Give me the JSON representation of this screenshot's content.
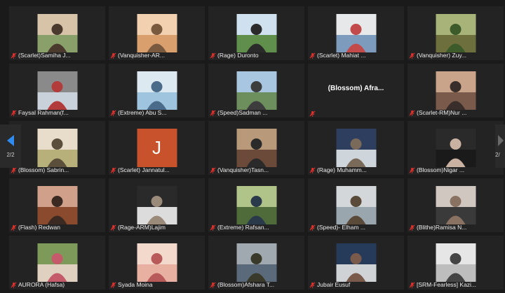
{
  "navigation": {
    "left_page": "2/2",
    "right_page": "2/"
  },
  "colors": {
    "background": "#1a1a1a",
    "tile": "#232323",
    "mic_muted": "#e5322d",
    "nav_arrow": "#2e8cf0",
    "initial_avatar": "#c8522b"
  },
  "participants": [
    {
      "label": "(Scarlet)Samiha J...",
      "avatar": "photo"
    },
    {
      "label": "(Vanquisher-AR...",
      "avatar": "photo"
    },
    {
      "label": "(Rage) Duronto",
      "avatar": "photo"
    },
    {
      "label": "(Scarlet) Mahiat ...",
      "avatar": "photo"
    },
    {
      "label": "(Vanquisher) Zuy...",
      "avatar": "photo"
    },
    {
      "label": "Faysal Rahman(f...",
      "avatar": "photo"
    },
    {
      "label": "(Extreme) Abu S...",
      "avatar": "photo"
    },
    {
      "label": "(Speed)Sadman ...",
      "avatar": "photo"
    },
    {
      "label": "",
      "avatar": "none",
      "display_name": "(Blossom) Afra..."
    },
    {
      "label": "(Scarlet-RM)Nur ...",
      "avatar": "photo"
    },
    {
      "label": "(Blossom) Sabrin...",
      "avatar": "photo"
    },
    {
      "label": "(Scarlet) Jannatul...",
      "avatar": "initial",
      "initial": "J"
    },
    {
      "label": "(Vanquisher)Tasn...",
      "avatar": "photo"
    },
    {
      "label": "(Rage) Muhamm...",
      "avatar": "photo"
    },
    {
      "label": "(Blossom)Nigar ...",
      "avatar": "photo"
    },
    {
      "label": "(Flash) Redwan",
      "avatar": "photo"
    },
    {
      "label": "(Rage-ARM)Lajim",
      "avatar": "photo"
    },
    {
      "label": "(Extreme) Rafsan...",
      "avatar": "photo"
    },
    {
      "label": "(Speed)- Elham ...",
      "avatar": "photo"
    },
    {
      "label": "(Blithe)Ramisa N...",
      "avatar": "photo"
    },
    {
      "label": "AURORA (Hafsa)",
      "avatar": "photo"
    },
    {
      "label": "Syada Moina",
      "avatar": "photo"
    },
    {
      "label": "(Blossom)Afshara T...",
      "avatar": "photo"
    },
    {
      "label": "Jubair Eusuf",
      "avatar": "photo"
    },
    {
      "label": "[SRM-Fearless] Kazi...",
      "avatar": "photo"
    }
  ]
}
